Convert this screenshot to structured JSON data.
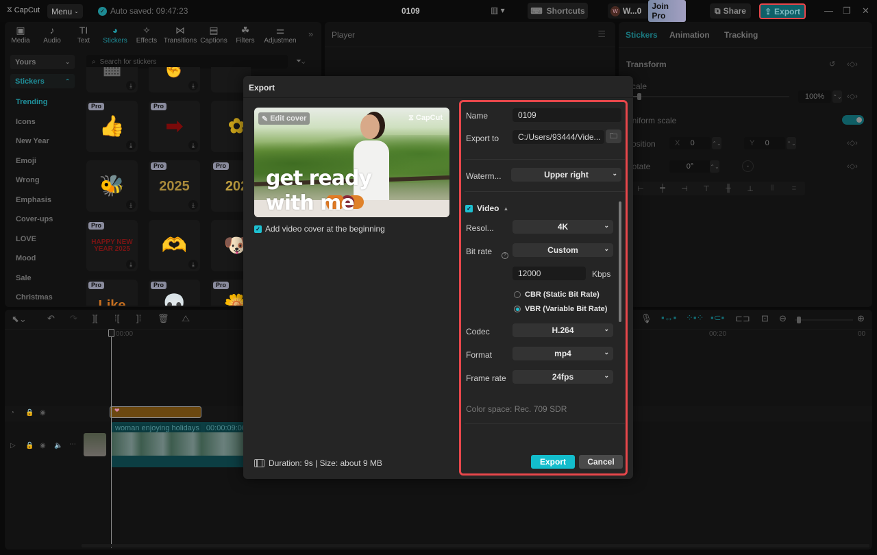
{
  "titlebar": {
    "app_name": "CapCut",
    "menu_label": "Menu",
    "autosave_text": "Auto saved: 09:47:23",
    "project_title": "0109",
    "shortcuts_label": "Shortcuts",
    "user_initial": "W",
    "user_name": "W...0",
    "join_pro_label": "Join Pro",
    "share_label": "Share",
    "export_label": "Export",
    "minimize_icon": "—",
    "maximize_icon": "❐",
    "close_icon": "✕"
  },
  "toolbar_tabs": [
    {
      "label": "Media",
      "icon": "▣"
    },
    {
      "label": "Audio",
      "icon": "♪"
    },
    {
      "label": "Text",
      "icon": "TI"
    },
    {
      "label": "Stickers",
      "icon": "◕",
      "active": true
    },
    {
      "label": "Effects",
      "icon": "✧"
    },
    {
      "label": "Transitions",
      "icon": "⋈"
    },
    {
      "label": "Captions",
      "icon": "▤"
    },
    {
      "label": "Filters",
      "icon": "☘"
    },
    {
      "label": "Adjustmen",
      "icon": "⚌"
    }
  ],
  "more_tabs_icon": "»",
  "sidebar": {
    "yours_label": "Yours",
    "stickers_label": "Stickers",
    "items": [
      "Trending",
      "Icons",
      "New Year",
      "Emoji",
      "Wrong",
      "Emphasis",
      "Cover-ups",
      "LOVE",
      "Mood",
      "Sale",
      "Christmas"
    ],
    "active_item": "Trending"
  },
  "sticker_search": {
    "placeholder": "Search for stickers"
  },
  "stickers": [
    {
      "name": "pixel-blur",
      "pro": false,
      "glyph": "▦"
    },
    {
      "name": "cursor-hand",
      "pro": false,
      "glyph": "☝"
    },
    {
      "name": "blank",
      "pro": false,
      "glyph": ""
    },
    {
      "name": "thumbs-up",
      "pro": true,
      "glyph": "👍"
    },
    {
      "name": "red-arrow",
      "pro": true,
      "glyph": "➡"
    },
    {
      "name": "daisy",
      "pro": false,
      "glyph": "✿"
    },
    {
      "name": "bee",
      "pro": false,
      "glyph": "🐝"
    },
    {
      "name": "gold-2025",
      "pro": true,
      "glyph": "2025"
    },
    {
      "name": "party-2025",
      "pro": true,
      "glyph": "202"
    },
    {
      "name": "happy-new-year-2025",
      "pro": true,
      "glyph": "HAPPY NEW YEAR 2025"
    },
    {
      "name": "heart-hands",
      "pro": false,
      "glyph": "🫶"
    },
    {
      "name": "corgi",
      "pro": false,
      "glyph": "🐶"
    },
    {
      "name": "like",
      "pro": true,
      "glyph": "Like"
    },
    {
      "name": "skull",
      "pro": true,
      "glyph": "💀"
    },
    {
      "name": "flower-sun",
      "pro": true,
      "glyph": "🌼"
    }
  ],
  "pro_badge": "Pro",
  "download_icon": "⤓",
  "player": {
    "title": "Player",
    "menu_icon": "☰"
  },
  "inspector": {
    "tabs": [
      "Stickers",
      "Animation",
      "Tracking"
    ],
    "active_tab": "Stickers",
    "transform_label": "Transform",
    "scale_label": "Scale",
    "scale_value": "100%",
    "scale_fraction": 0.08,
    "uniform_scale_label": "Uniform scale",
    "uniform_scale_on": true,
    "position_label": "Position",
    "position_x_label": "X",
    "position_x": "0",
    "position_y_label": "Y",
    "position_y": "0",
    "rotate_label": "Rotate",
    "rotate_value": "0°"
  },
  "timeline": {
    "ruler_start": "00:00",
    "ruler_mid": "00:20",
    "ruler_end": "00",
    "video_clip_name": "woman enjoying holidays",
    "video_clip_duration": "00:00:09:00"
  },
  "export_dialog": {
    "title": "Export",
    "edit_cover_label": "Edit cover",
    "cover_watermark": "CapCut",
    "cover_text_line1": "get ready",
    "cover_text_line2": "with me",
    "add_cover_label": "Add video cover at the beginning",
    "add_cover_checked": true,
    "duration_text": "Duration: 9s | Size: about 9 MB",
    "name_label": "Name",
    "name_value": "0109",
    "export_to_label": "Export to",
    "export_to_value": "C:/Users/93444/Vide...",
    "watermark_label": "Waterm...",
    "watermark_value": "Upper right",
    "video_section_label": "Video",
    "video_checked": true,
    "resolution_label": "Resol...",
    "resolution_value": "4K",
    "bitrate_label": "Bit rate",
    "bitrate_value": "Custom",
    "bitrate_kbps": "12000",
    "bitrate_unit": "Kbps",
    "cbr_label": "CBR (Static Bit Rate)",
    "vbr_label": "VBR (Variable Bit Rate)",
    "selected_rate_mode": "VBR",
    "codec_label": "Codec",
    "codec_value": "H.264",
    "format_label": "Format",
    "format_value": "mp4",
    "framerate_label": "Frame rate",
    "framerate_value": "24fps",
    "color_space_text": "Color space: Rec. 709 SDR",
    "export_button": "Export",
    "cancel_button": "Cancel"
  },
  "colors": {
    "accent": "#13bdcc",
    "highlight_border": "#e8474b",
    "active_tab": "#1f8f9a"
  }
}
